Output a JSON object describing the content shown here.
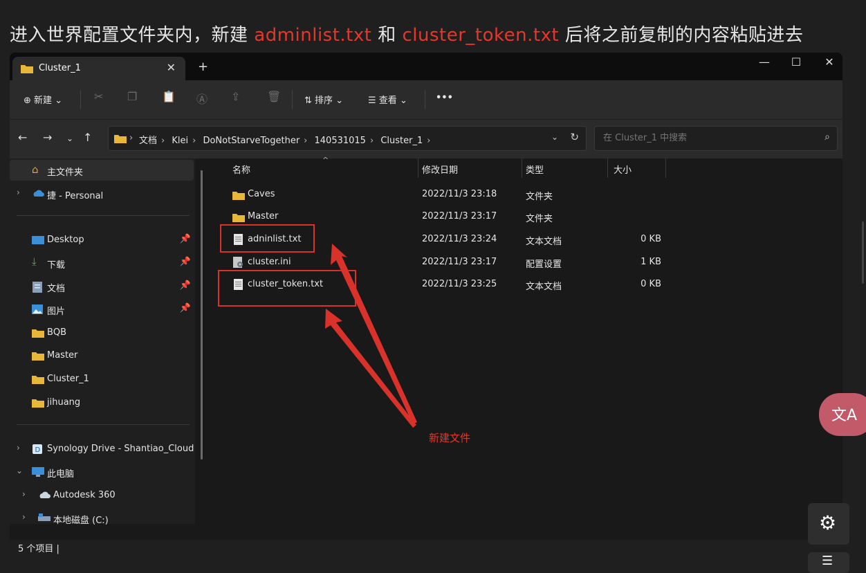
{
  "heading": {
    "part1": "进入世界配置文件夹内，新建 ",
    "file1": "adminlist.txt",
    "part2": " 和 ",
    "file2": "cluster_token.txt",
    "part3": " 后将之前复制的内容粘贴进去"
  },
  "window": {
    "tab_title": "Cluster_1",
    "tab_close": "✕",
    "new_tab": "+",
    "controls": {
      "minimize": "—",
      "maximize": "☐",
      "close": "✕"
    }
  },
  "toolbar": {
    "new_label": "新建",
    "sort_label": "排序",
    "view_label": "查看",
    "more_label": "•••"
  },
  "address": {
    "crumbs": [
      "文档",
      "Klei",
      "DoNotStarveTogether",
      "140531015",
      "Cluster_1"
    ],
    "search_placeholder": "在 Cluster_1 中搜索"
  },
  "sidebar": {
    "home": "主文件夹",
    "personal": "捷 - Personal",
    "quick": [
      {
        "label": "Desktop",
        "pinned": true
      },
      {
        "label": "下载",
        "pinned": true
      },
      {
        "label": "文档",
        "pinned": true
      },
      {
        "label": "图片",
        "pinned": true
      },
      {
        "label": "BQB",
        "pinned": false
      },
      {
        "label": "Master",
        "pinned": false
      },
      {
        "label": "Cluster_1",
        "pinned": false
      },
      {
        "label": "jihuang",
        "pinned": false
      }
    ],
    "synology": "Synology Drive - Shantiao_Cloud",
    "this_pc": "此电脑",
    "autodesk": "Autodesk 360",
    "local_disk": "本地磁盘 (C:)"
  },
  "columns": {
    "name": "名称",
    "date": "修改日期",
    "type": "类型",
    "size": "大小"
  },
  "files": [
    {
      "name": "Caves",
      "date": "2022/11/3 23:18",
      "type": "文件夹",
      "size": "",
      "icon": "folder"
    },
    {
      "name": "Master",
      "date": "2022/11/3 23:17",
      "type": "文件夹",
      "size": "",
      "icon": "folder"
    },
    {
      "name": "adninlist.txt",
      "date": "2022/11/3 23:24",
      "type": "文本文档",
      "size": "0 KB",
      "icon": "text"
    },
    {
      "name": "cluster.ini",
      "date": "2022/11/3 23:17",
      "type": "配置设置",
      "size": "1 KB",
      "icon": "ini"
    },
    {
      "name": "cluster_token.txt",
      "date": "2022/11/3 23:25",
      "type": "文本文档",
      "size": "0 KB",
      "icon": "text"
    }
  ],
  "status": {
    "count": "5 个项目  |"
  },
  "annotation": {
    "label": "新建文件"
  },
  "colors": {
    "accent_red": "#e8362a",
    "folder_yellow": "#e8b73a"
  }
}
